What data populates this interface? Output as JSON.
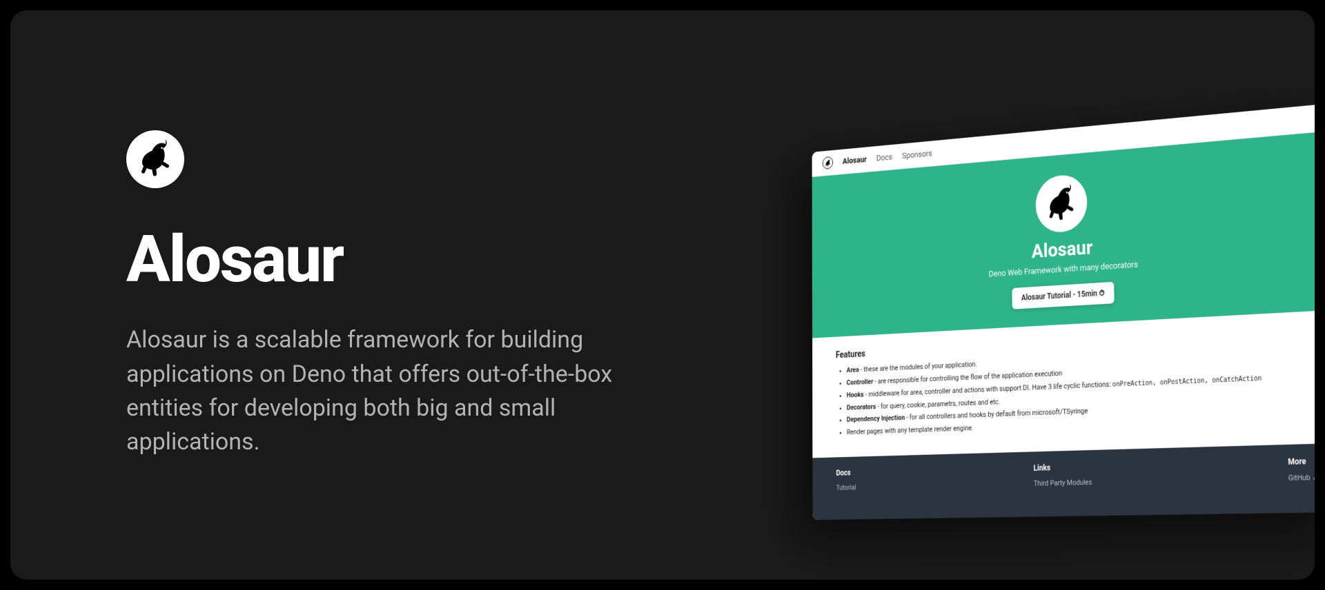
{
  "main": {
    "title": "Alosaur",
    "description": "Alosaur is a scalable framework for building applications on Deno that offers out-of-the-box entities for developing both big and small applications."
  },
  "mock": {
    "nav": {
      "brand": "Alosaur",
      "links": [
        "Docs",
        "Sponsors"
      ]
    },
    "hero": {
      "title": "Alosaur",
      "subtitle": "Deno Web Framework with many decorators",
      "button": "Alosaur Tutorial - 15min ⏱"
    },
    "features": {
      "heading": "Features",
      "items": [
        {
          "term": "Area",
          "text": " - these are the modules of your application."
        },
        {
          "term": "Controller",
          "text": " - are responsible for controlling the flow of the application execution"
        },
        {
          "term": "Hooks",
          "text": " - middleware for area, controller and actions with support DI. Have 3 life cyclic functions: ",
          "code": "onPreAction, onPostAction, onCatchAction"
        },
        {
          "term": "Decorators",
          "text": " - for query, cookie, parametrs, routes and etc."
        },
        {
          "term": "Dependency Injection",
          "text": " - for all controllers and hooks by default from microsoft/TSyringe"
        },
        {
          "term": "",
          "text": "Render pages with any template render engine."
        }
      ]
    },
    "footer": {
      "cols": [
        {
          "title": "Docs",
          "links": [
            "Tutorial"
          ]
        },
        {
          "title": "Links",
          "links": [
            "Third Party Modules"
          ]
        },
        {
          "title": "More",
          "links": [
            "GitHub ↗"
          ]
        }
      ]
    }
  }
}
